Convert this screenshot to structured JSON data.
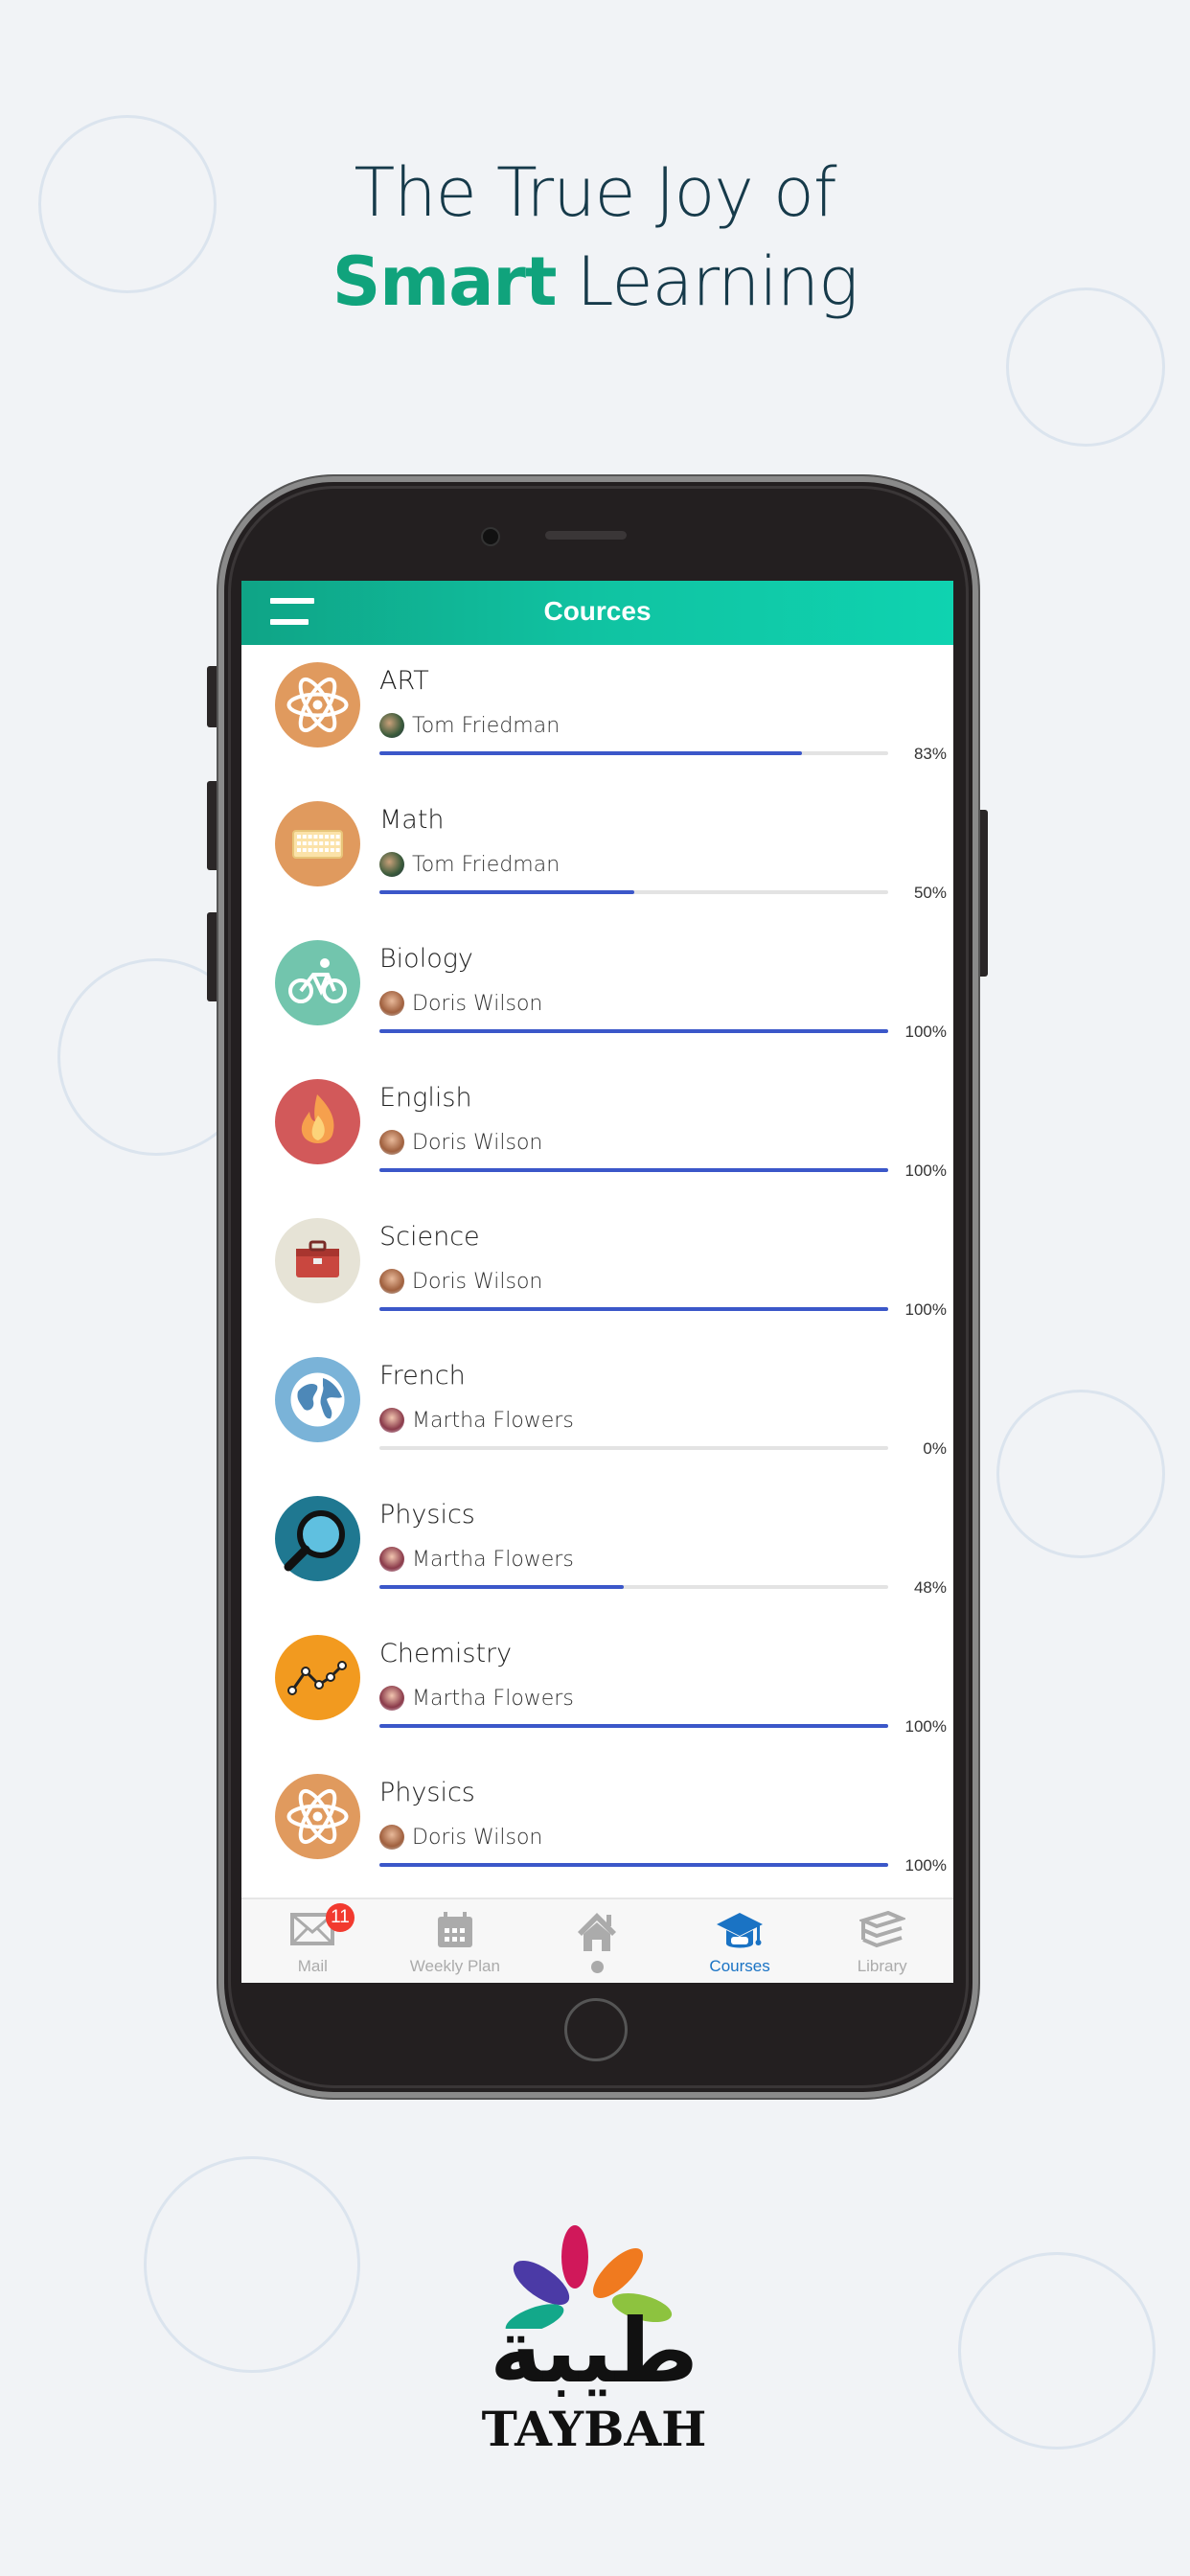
{
  "headline": {
    "line1": "The True Joy of",
    "smart": "Smart",
    "learning": " Learning"
  },
  "app": {
    "title": "Cources"
  },
  "colors": {
    "header": "#10c3a2",
    "progress": "#3b57c9",
    "active_tab": "#1a73c4",
    "badge": "#f23a2f",
    "smart": "#10a37c"
  },
  "courses": [
    {
      "name": "ART",
      "teacher": "Tom Friedman",
      "progress": 83,
      "progress_label": "83%",
      "icon": "atom-icon",
      "color": "#e09a5e"
    },
    {
      "name": "Math",
      "teacher": "Tom Friedman",
      "progress": 50,
      "progress_label": "50%",
      "icon": "keyboard-icon",
      "color": "#e09a5e"
    },
    {
      "name": "Biology",
      "teacher": "Doris Wilson",
      "progress": 100,
      "progress_label": "100%",
      "icon": "bicycle-icon",
      "color": "#72c5ad"
    },
    {
      "name": "English",
      "teacher": "Doris Wilson",
      "progress": 100,
      "progress_label": "100%",
      "icon": "fire-icon",
      "color": "#d2595a"
    },
    {
      "name": "Science",
      "teacher": "Doris Wilson",
      "progress": 100,
      "progress_label": "100%",
      "icon": "toolbox-icon",
      "color": "#e6e3d6"
    },
    {
      "name": "French",
      "teacher": "Martha Flowers",
      "progress": 0,
      "progress_label": "0%",
      "icon": "globe-icon",
      "color": "#7ab3d8"
    },
    {
      "name": "Physics",
      "teacher": "Martha Flowers",
      "progress": 48,
      "progress_label": "48%",
      "icon": "magnifier-icon",
      "color": "#1f7891"
    },
    {
      "name": "Chemistry",
      "teacher": "Martha Flowers",
      "progress": 100,
      "progress_label": "100%",
      "icon": "line-chart-icon",
      "color": "#f29a1f"
    },
    {
      "name": "Physics",
      "teacher": "Doris Wilson",
      "progress": 100,
      "progress_label": "100%",
      "icon": "atom-icon",
      "color": "#e09a5e"
    }
  ],
  "tabs": [
    {
      "label": "Mail",
      "icon": "mail-icon",
      "badge": "11"
    },
    {
      "label": "Weekly Plan",
      "icon": "calendar-icon"
    },
    {
      "label": "",
      "icon": "home-icon"
    },
    {
      "label": "Courses",
      "icon": "graduation-cap-icon",
      "active": true
    },
    {
      "label": "Library",
      "icon": "books-icon"
    }
  ],
  "logo": {
    "arabic": "طيبة",
    "name": "TAYBAH"
  }
}
